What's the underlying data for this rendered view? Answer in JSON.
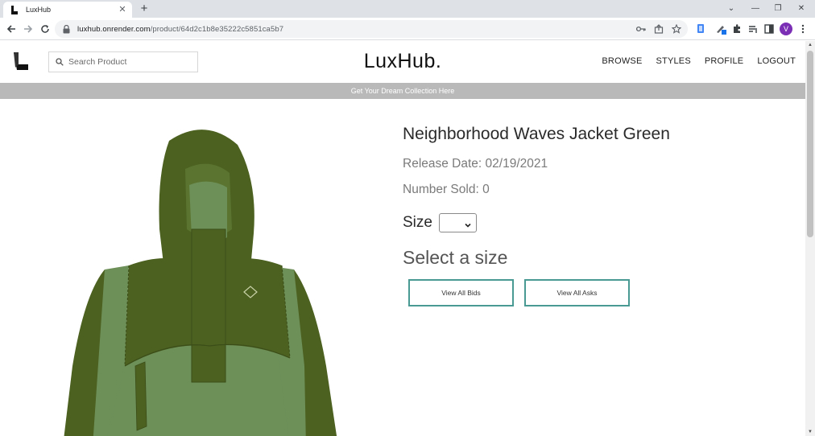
{
  "browser": {
    "tab_title": "LuxHub",
    "url_host": "luxhub.onrender.com",
    "url_path": "/product/64d2c1b8e35222c5851ca5b7",
    "profile_initial": "V"
  },
  "header": {
    "search_placeholder": "Search Product",
    "brand": "LuxHub.",
    "nav": [
      "BROWSE",
      "STYLES",
      "PROFILE",
      "LOGOUT"
    ]
  },
  "banner": "Get Your Dream Collection Here",
  "product": {
    "name": "Neighborhood Waves Jacket Green",
    "release_date": "Release Date: 02/19/2021",
    "number_sold": "Number Sold: 0",
    "size_label": "Size",
    "size_selected": "",
    "select_prompt": "Select a size",
    "view_bids_label": "View All Bids",
    "view_asks_label": "View All Asks"
  },
  "colors": {
    "jacket_dark": "#4c6120",
    "jacket_light": "#6d8f58",
    "button_border": "#4a9a94",
    "banner_bg": "#b9b9b9"
  }
}
